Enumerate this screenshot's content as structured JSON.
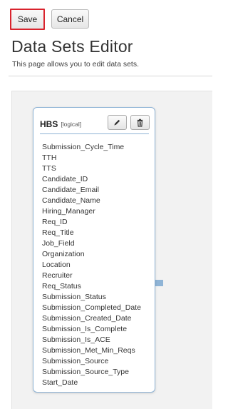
{
  "toolbar": {
    "save_label": "Save",
    "cancel_label": "Cancel"
  },
  "page": {
    "title": "Data Sets Editor",
    "subtitle": "This page allows you to edit data sets."
  },
  "dataset": {
    "name": "HBS",
    "type": "[logical]",
    "edit_icon": "pencil-icon",
    "delete_icon": "trash-icon",
    "fields": [
      "Submission_Cycle_Time",
      "TTH",
      "TTS",
      "Candidate_ID",
      "Candidate_Email",
      "Candidate_Name",
      "Hiring_Manager",
      "Req_ID",
      "Req_Title",
      "Job_Field",
      "Organization",
      "Location",
      "Recruiter",
      "Req_Status",
      "Submission_Status",
      "Submission_Completed_Date",
      "Submission_Created_Date",
      "Submission_Is_Complete",
      "Submission_Is_ACE",
      "Submission_Met_Min_Reqs",
      "Submission_Source",
      "Submission_Source_Type",
      "Start_Date"
    ]
  },
  "colors": {
    "highlight": "#d9232d",
    "card_border": "#8fb4d6",
    "canvas_bg": "#f2f2f2"
  }
}
